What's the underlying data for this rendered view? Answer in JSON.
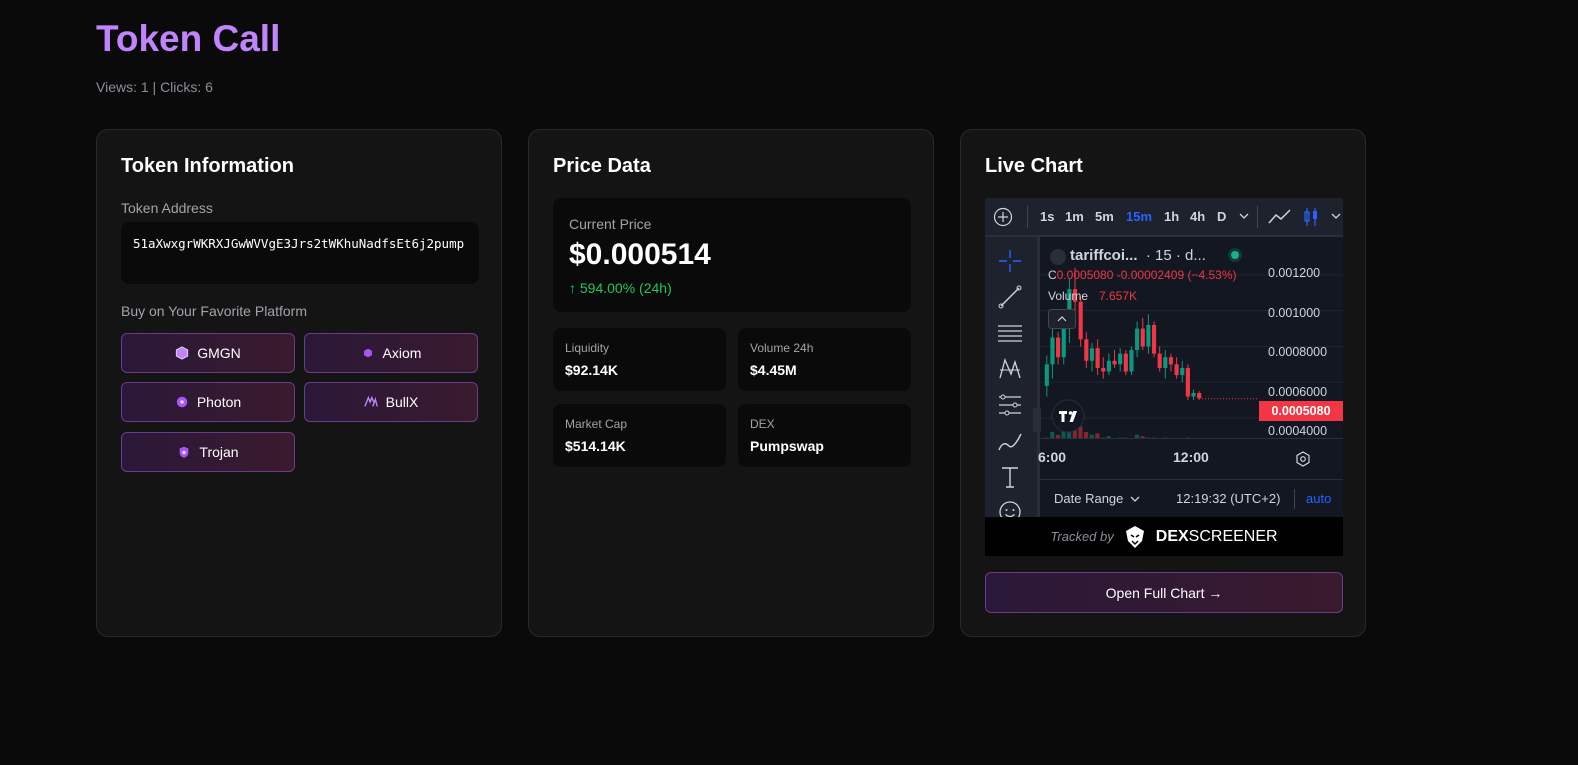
{
  "header": {
    "title": "Token Call",
    "stats": "Views: 1 | Clicks: 6"
  },
  "token_info": {
    "heading": "Token Information",
    "address_label": "Token Address",
    "address": "51aXwxgrWKRXJGwWVVgE3Jrs2tWKhuNadfsEt6j2pump",
    "platforms_label": "Buy on Your Favorite Platform",
    "platforms": [
      {
        "label": "GMGN",
        "icon": "hexagon-icon"
      },
      {
        "label": "Axiom",
        "icon": "hexagon-icon"
      },
      {
        "label": "Photon",
        "icon": "circle-dot-icon"
      },
      {
        "label": "BullX",
        "icon": "bullx-logo-icon"
      },
      {
        "label": "Trojan",
        "icon": "shield-icon"
      }
    ]
  },
  "price_data": {
    "heading": "Price Data",
    "current_price_label": "Current Price",
    "current_price": "$0.000514",
    "change": "↑ 594.00% (24h)",
    "metrics": [
      {
        "label": "Liquidity",
        "value": "$92.14K"
      },
      {
        "label": "Volume 24h",
        "value": "$4.45M"
      },
      {
        "label": "Market Cap",
        "value": "$514.14K"
      },
      {
        "label": "DEX",
        "value": "Pumpswap"
      }
    ]
  },
  "live_chart": {
    "heading": "Live Chart",
    "timeframes": [
      "1s",
      "1m",
      "5m",
      "15m",
      "1h",
      "4h",
      "D"
    ],
    "active_timeframe": "15m",
    "symbol": "tariffcoi...",
    "symbol_meta": "· 15 · d...",
    "ohlc_prefix": "C",
    "ohlc": "0.0005080  -0.00002409 (−4.53%)",
    "volume_label": "Volume",
    "volume_value": "7.657K",
    "price_axis": [
      "0.001200",
      "0.001000",
      "0.0008000",
      "0.0006000",
      "0.0004000"
    ],
    "last_price": "0.0005080",
    "time_axis": [
      "6:00",
      "12:00"
    ],
    "date_range_label": "Date Range",
    "clock": "12:19:32 (UTC+2)",
    "auto_label": "auto",
    "tracked_by": "Tracked by",
    "dex_brand_bold": "DEX",
    "dex_brand_rest": "SCREENER",
    "open_button": "Open Full Chart →",
    "colors": {
      "up": "#089981",
      "down": "#f23645",
      "accent": "#2962ff"
    }
  },
  "chart_data": {
    "type": "candlestick",
    "ylim": [
      0.00035,
      0.0013
    ],
    "last_price": 0.000508,
    "candles": [
      {
        "o": 0.00058,
        "h": 0.00075,
        "l": 0.00052,
        "c": 0.0007
      },
      {
        "o": 0.0007,
        "h": 0.0009,
        "l": 0.00062,
        "c": 0.00085
      },
      {
        "o": 0.00085,
        "h": 0.00088,
        "l": 0.0007,
        "c": 0.00074
      },
      {
        "o": 0.00074,
        "h": 0.00095,
        "l": 0.0007,
        "c": 0.0009
      },
      {
        "o": 0.0009,
        "h": 0.00118,
        "l": 0.00082,
        "c": 0.00112
      },
      {
        "o": 0.00112,
        "h": 0.00124,
        "l": 0.001,
        "c": 0.00105
      },
      {
        "o": 0.00105,
        "h": 0.00108,
        "l": 0.0008,
        "c": 0.00084
      },
      {
        "o": 0.00084,
        "h": 0.00088,
        "l": 0.00068,
        "c": 0.00072
      },
      {
        "o": 0.00072,
        "h": 0.00082,
        "l": 0.00066,
        "c": 0.00079
      },
      {
        "o": 0.00079,
        "h": 0.00084,
        "l": 0.00064,
        "c": 0.00068
      },
      {
        "o": 0.00068,
        "h": 0.00074,
        "l": 0.00062,
        "c": 0.00066
      },
      {
        "o": 0.00066,
        "h": 0.00076,
        "l": 0.00064,
        "c": 0.00072
      },
      {
        "o": 0.00072,
        "h": 0.00078,
        "l": 0.00068,
        "c": 0.0007
      },
      {
        "o": 0.0007,
        "h": 0.00079,
        "l": 0.00066,
        "c": 0.00076
      },
      {
        "o": 0.00076,
        "h": 0.00078,
        "l": 0.00064,
        "c": 0.00066
      },
      {
        "o": 0.00066,
        "h": 0.0008,
        "l": 0.00064,
        "c": 0.00078
      },
      {
        "o": 0.00078,
        "h": 0.00094,
        "l": 0.00074,
        "c": 0.0009
      },
      {
        "o": 0.0009,
        "h": 0.00096,
        "l": 0.00078,
        "c": 0.0008
      },
      {
        "o": 0.0008,
        "h": 0.00098,
        "l": 0.00076,
        "c": 0.00092
      },
      {
        "o": 0.00092,
        "h": 0.00094,
        "l": 0.00074,
        "c": 0.00076
      },
      {
        "o": 0.00076,
        "h": 0.0008,
        "l": 0.00066,
        "c": 0.00068
      },
      {
        "o": 0.00068,
        "h": 0.00078,
        "l": 0.00062,
        "c": 0.00074
      },
      {
        "o": 0.00074,
        "h": 0.00076,
        "l": 0.00066,
        "c": 0.0007
      },
      {
        "o": 0.0007,
        "h": 0.00074,
        "l": 0.00062,
        "c": 0.00064
      },
      {
        "o": 0.00064,
        "h": 0.00072,
        "l": 0.0006,
        "c": 0.00068
      },
      {
        "o": 0.00068,
        "h": 0.0007,
        "l": 0.0005,
        "c": 0.00052
      },
      {
        "o": 0.00052,
        "h": 0.00056,
        "l": 0.0005,
        "c": 0.00054
      },
      {
        "o": 0.00054,
        "h": 0.00055,
        "l": 0.0005,
        "c": 0.00051
      }
    ],
    "volume": [
      0.3,
      0.5,
      0.4,
      0.6,
      0.9,
      0.8,
      0.7,
      0.5,
      0.4,
      0.45,
      0.3,
      0.35,
      0.25,
      0.3,
      0.3,
      0.28,
      0.4,
      0.35,
      0.3,
      0.3,
      0.25,
      0.3,
      0.2,
      0.25,
      0.2,
      0.3,
      0.15,
      0.1
    ]
  }
}
